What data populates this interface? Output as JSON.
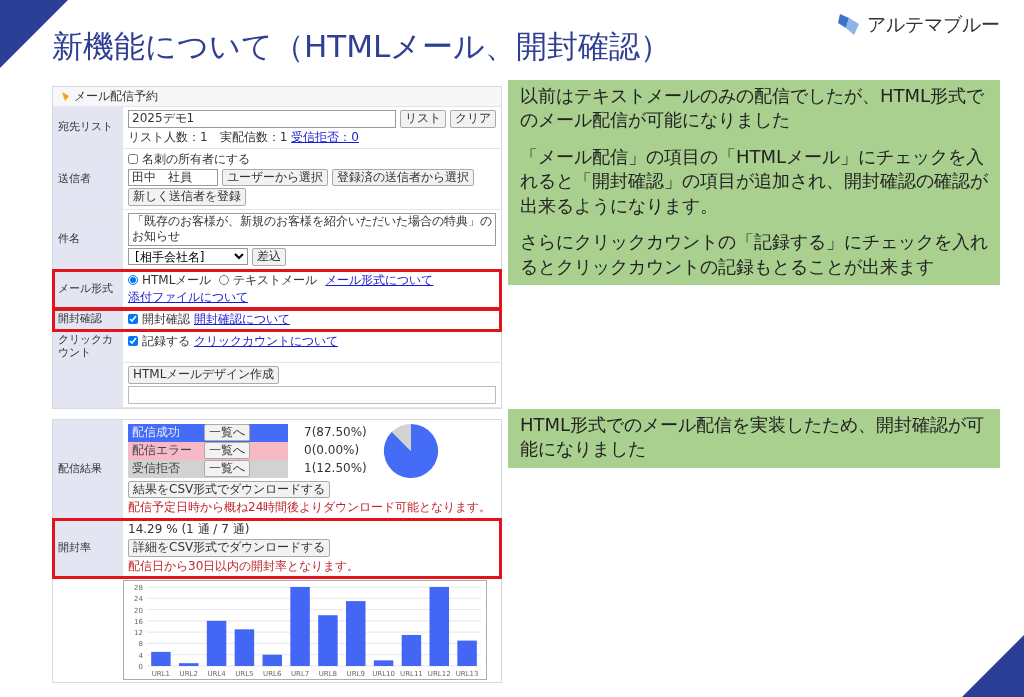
{
  "slide": {
    "title": "新機能について（HTMLメール、開封確認）",
    "logo": "アルテマブルー"
  },
  "form": {
    "header": "メール配信予約",
    "rows": [
      {
        "kind": "list",
        "label": "宛先リスト",
        "highlighted": false,
        "value": "2025デモ1",
        "buttons": [
          "リスト",
          "クリア"
        ],
        "info": "リスト人数：1　実配信数：1",
        "link": "受信拒否：0"
      },
      {
        "kind": "sender",
        "label": "送信者",
        "highlighted": false,
        "checkbox": {
          "label": "名刺の所有者にする",
          "checked": false
        },
        "value": "田中　社員",
        "buttons": [
          "ユーザーから選択",
          "登録済の送信者から選択",
          "新しく送信者を登録"
        ]
      },
      {
        "kind": "subject",
        "label": "件名",
        "highlighted": false,
        "value": "「既存のお客様が、新規のお客様を紹介いただいた場合の特典」のお知らせ",
        "select": "[相手会社名]",
        "buttons": [
          "差込"
        ]
      },
      {
        "kind": "radio",
        "label": "メール形式",
        "highlighted": true,
        "options": [
          {
            "label": "HTMLメール",
            "selected": true
          },
          {
            "label": "テキストメール",
            "selected": false
          }
        ],
        "links": [
          "メール形式について",
          "添付ファイルについて"
        ]
      },
      {
        "kind": "check",
        "label": "開封確認",
        "highlighted": true,
        "checkbox": {
          "label": "開封確認",
          "checked": true
        },
        "links": [
          "開封確認について"
        ]
      },
      {
        "kind": "check",
        "label": "クリックカウント",
        "highlighted": false,
        "checkbox": {
          "label": "記録する",
          "checked": true
        },
        "links": [
          "クリックカウントについて"
        ]
      },
      {
        "kind": "editor",
        "highlighted": false,
        "buttons": [
          "HTMLメールデザイン作成"
        ]
      }
    ]
  },
  "notes": [
    {
      "paragraphs": [
        "以前はテキストメールのみの配信でしたが、HTML形式でのメール配信が可能になりました",
        "「メール配信」の項目の「HTMLメール」にチェックを入れると「開封確認」の項目が追加され、開封確認の確認が出来るようになります。",
        "さらにクリックカウントの「記録する」にチェックを入れるとクリックカウントの記録もとることが出来ます"
      ]
    },
    {
      "paragraphs": [
        "HTML形式でのメール配信を実装したため、開封確認が可能になりました"
      ]
    }
  ],
  "results": {
    "rows": [
      {
        "kind": "delivery",
        "label": "配信結果",
        "highlighted": false,
        "items": [
          {
            "name": "配信成功",
            "button": "一覧へ",
            "count": "7(87.50%)",
            "color": "#456cf6"
          },
          {
            "name": "配信エラー",
            "button": "一覧へ",
            "count": "0(0.00%)",
            "color": "#f6b9c5"
          },
          {
            "name": "受信拒否",
            "button": "一覧へ",
            "count": "1(12.50%)",
            "color": "#d2d2d2"
          }
        ],
        "chart_data": {
          "type": "pie",
          "values": [
            87.5,
            0,
            12.5
          ]
        },
        "button": "結果をCSV形式でダウンロードする",
        "note": "配信予定日時から概ね24時間後よりダウンロード可能となります。"
      },
      {
        "kind": "open",
        "label": "開封率",
        "highlighted": true,
        "value": "14.29 % (1 通 / 7 通)",
        "button": "詳細をCSV形式でダウンロードする",
        "note": "配信日から30日以内の開封率となります。"
      }
    ],
    "click_chart": {
      "chart_data": {
        "type": "bar",
        "categories": [
          "URL1",
          "URL2",
          "URL4",
          "URL5",
          "URL6",
          "URL7",
          "URL8",
          "URL9",
          "URL10",
          "URL11",
          "URL12",
          "URL13"
        ],
        "values": [
          5,
          1,
          16,
          13,
          4,
          28,
          18,
          23,
          2,
          11,
          28,
          9
        ],
        "ylim": [
          0,
          28
        ],
        "yticks": [
          0,
          4,
          8,
          12,
          16,
          20,
          24,
          28
        ],
        "grid": true
      }
    }
  }
}
